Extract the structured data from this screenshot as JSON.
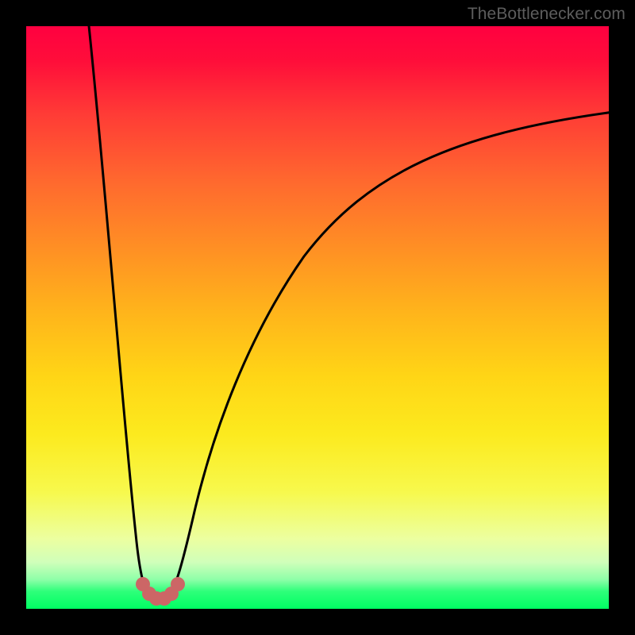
{
  "attribution": "TheBottlenecker.com",
  "colors": {
    "marker": "#cc6666",
    "curve": "#000000",
    "gradient_stops": [
      "#ff0040",
      "#ff3b36",
      "#ff8f24",
      "#ffd516",
      "#f7f94d",
      "#d0ffba",
      "#00ff63"
    ]
  },
  "chart_data": {
    "type": "line",
    "title": "",
    "xlabel": "",
    "ylabel": "",
    "xlim": [
      0,
      100
    ],
    "ylim": [
      0,
      100
    ],
    "series": [
      {
        "name": "left-branch",
        "x": [
          10,
          12,
          14,
          16,
          18,
          19,
          20,
          21
        ],
        "y": [
          100,
          83,
          66,
          49,
          31,
          19,
          8,
          2
        ]
      },
      {
        "name": "right-branch",
        "x": [
          24,
          25,
          26,
          28,
          31,
          35,
          40,
          46,
          53,
          62,
          72,
          84,
          100
        ],
        "y": [
          2,
          7,
          14,
          25,
          37,
          48,
          57,
          64,
          70,
          75,
          79,
          82,
          85
        ]
      }
    ],
    "markers": {
      "name": "valley-cluster",
      "x": [
        19.5,
        20.5,
        21.5,
        22.5,
        23.5,
        24.5
      ],
      "y": [
        4,
        2,
        1,
        1,
        2,
        4
      ]
    }
  }
}
